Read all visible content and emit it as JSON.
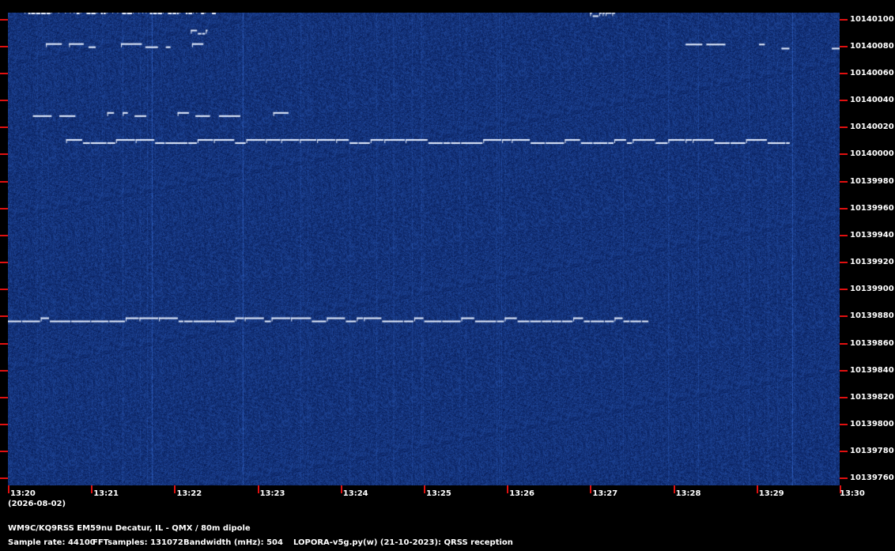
{
  "chart_data": {
    "type": "heatmap",
    "title": "",
    "subtitle": "",
    "xlabel": "",
    "ylabel": "",
    "x_ticks": [
      "13:20",
      "13:21",
      "13:22",
      "13:23",
      "13:24",
      "13:25",
      "13:26",
      "13:27",
      "13:28",
      "13:29",
      "13:30"
    ],
    "x_range": [
      "13:20",
      "13:30"
    ],
    "date_label": "(2026-08-02)",
    "y_ticks": [
      10140100,
      10140080,
      10140060,
      10140040,
      10140020,
      10140000,
      10139980,
      10139960,
      10139940,
      10139920,
      10139900,
      10139880,
      10139860,
      10139840,
      10139820,
      10139800,
      10139780,
      10139760
    ],
    "y_range": [
      10139755,
      10140105
    ],
    "colors": {
      "background": "#0a2a66",
      "signal": "#e8f0ff",
      "tick": "#e01010",
      "text": "#ffffff"
    },
    "signals": [
      {
        "start": "13:20.2",
        "end": "13:22.5",
        "freq": 10140105,
        "mod": "fsk_dense"
      },
      {
        "start": "13:20.1",
        "end": "13:22.5",
        "freq": 10140080,
        "mod": "fsk_sparse"
      },
      {
        "start": "13:22.2",
        "end": "13:22.4",
        "freq": 10140090,
        "mod": "fsk_dense"
      },
      {
        "start": "13:20.3",
        "end": "13:23.4",
        "freq": 10140029,
        "mod": "fsk_sparse"
      },
      {
        "start": "13:20.7",
        "end": "13:29.4",
        "freq": 10140009,
        "mod": "fsk"
      },
      {
        "start": "13:20.0",
        "end": "13:27.7",
        "freq": 10139877,
        "mod": "fsk"
      },
      {
        "start": "13:27.9",
        "end": "13:29.1",
        "freq": 10140082,
        "mod": "fsk_sparse"
      },
      {
        "start": "13:29.3",
        "end": "13:30.0",
        "freq": 10140079,
        "mod": "fsk_sparse"
      },
      {
        "start": "13:27.0",
        "end": "13:27.3",
        "freq": 10140103,
        "mod": "fsk_dense"
      }
    ]
  },
  "footer": {
    "station": "WM9C/KQ9RSS EM59nu Decatur, IL - QMX / 80m dipole",
    "sample_rate": "Sample rate: 44100",
    "fft_samples": "FFTsamples: 131072",
    "bandwidth": "Bandwidth (mHz): 504",
    "software": "LOPORA-v5g.py(w) (21-10-2023): QRSS reception"
  }
}
